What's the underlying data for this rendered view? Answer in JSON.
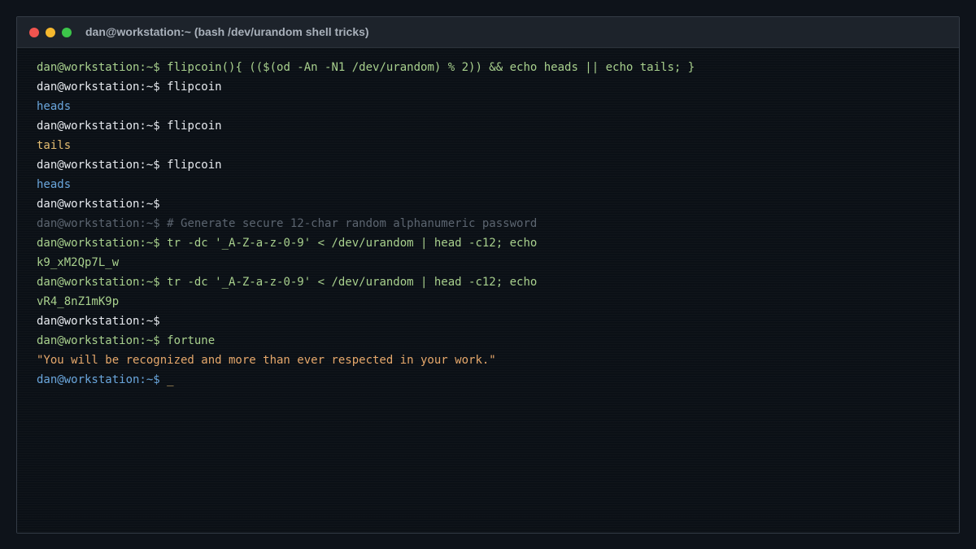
{
  "window": {
    "title": "dan@workstation:~ (bash /dev/urandom shell tricks)"
  },
  "terminal": {
    "lines": {
      "l0": {
        "prompt": "dan@workstation:~$ ",
        "cmd": "flipcoin(){ (($(od -An -N1 /dev/urandom) % 2)) && echo heads || echo tails; }"
      },
      "l1": {
        "prompt": "dan@workstation:~$ ",
        "cmd": "flipcoin"
      },
      "l2": {
        "out": "heads"
      },
      "l3": {
        "prompt": "dan@workstation:~$ ",
        "cmd": "flipcoin"
      },
      "l4": {
        "out": "tails"
      },
      "l5": {
        "prompt": "dan@workstation:~$ ",
        "cmd": "flipcoin"
      },
      "l6": {
        "out": "heads"
      },
      "l7": {
        "prompt": "dan@workstation:~$",
        "cmd": ""
      },
      "l8": {
        "prompt": "dan@workstation:~$ ",
        "cmd": "# Generate secure 12-char random alphanumeric password"
      },
      "l9": {
        "prompt": "dan@workstation:~$ ",
        "cmd": "tr -dc '_A-Z-a-z-0-9' < /dev/urandom | head -c12; echo"
      },
      "l10": {
        "out": "k9_xM2Qp7L_w"
      },
      "l11": {
        "prompt": "dan@workstation:~$ ",
        "cmd": "tr -dc '_A-Z-a-z-0-9' < /dev/urandom | head -c12; echo"
      },
      "l12": {
        "out": "vR4_8nZ1mK9p"
      },
      "l13": {
        "prompt": "dan@workstation:~$",
        "cmd": ""
      },
      "l14": {
        "prompt": "dan@workstation:~$ ",
        "cmd": "fortune"
      },
      "l15": {
        "out": "\"You will be recognized and more than ever respected in your work.\""
      },
      "l16": {
        "prompt": "dan@workstation:~$ ",
        "cursor": "_"
      }
    }
  },
  "colors": {
    "background": "#0b1016",
    "titlebar": "#1d232b",
    "prompt": "#e6e9ee",
    "green": "#a8d08d",
    "blue": "#6aa6dc",
    "yellow": "#e4bd72",
    "orange": "#e6a86b",
    "dim": "#5c6570",
    "close": "#f0544f",
    "minimize": "#f5b82e",
    "maximize": "#3cc54a"
  }
}
